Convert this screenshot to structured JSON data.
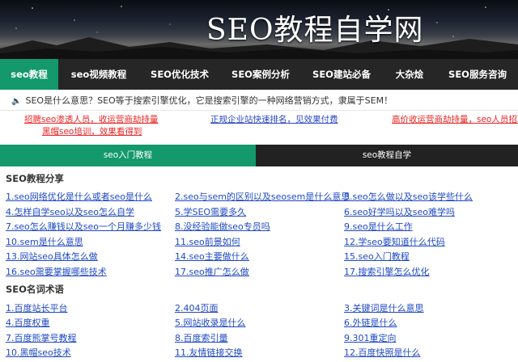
{
  "header": {
    "title": "SEO教程自学网"
  },
  "nav": [
    {
      "label": "seo教程",
      "active": true
    },
    {
      "label": "seo视频教程"
    },
    {
      "label": "SEO优化技术"
    },
    {
      "label": "SEO案例分析"
    },
    {
      "label": "SEO建站必备"
    },
    {
      "label": "大杂烩"
    },
    {
      "label": "SEO服务咨询"
    }
  ],
  "notice": {
    "text": "SEO是什么意思？SEO等于搜索引擎优化，它是搜索引擎的一种网络营销方式，隶属于SEM！"
  },
  "ads": [
    {
      "text": "招聘seo渗透人员，收运营商劫持量",
      "color": "red"
    },
    {
      "text": "黑帽seo培训，效果看得到",
      "color": "red"
    },
    {
      "text": "正规企业站快速排名，见效果付费",
      "color": "blue"
    },
    {
      "text": "高价收运营商劫持量，seo人员招聘",
      "color": "red"
    }
  ],
  "tabs": [
    {
      "label": "seo入门教程"
    },
    {
      "label": "seo教程自学"
    }
  ],
  "sections": [
    {
      "title": "SEO教程分享",
      "items": [
        "1.seo网络优化是什么或者seo是什么",
        "2.seo与sem的区别以及seosem是什么意思",
        "3.seo怎么做以及seo该学些什么",
        "4.怎样自学seo以及seo怎么自学",
        "5.学SEO需要多久",
        "6.seo好学吗以及seo难学吗",
        "7.seo怎么赚钱以及seo一个月赚多少钱",
        "8.没经验能做seo专员吗",
        "9.seo是什么工作",
        "10.sem是什么意思",
        "11.seo前景如何",
        "12.学seo要知道什么代码",
        "13.网站seo具体怎么做",
        "14.seo主要做什么",
        "15.seo入门教程",
        "16.seo需要掌握哪些技术",
        "17.seo推广怎么做",
        "17.搜索引擎怎么优化"
      ]
    },
    {
      "title": "SEO名词术语",
      "items": [
        "1.百度站长平台",
        "2.404页面",
        "3.关键词是什么意思",
        "4.百度权重",
        "5.网站收录是什么",
        "6.外链是什么",
        "7.百度熊掌号教程",
        "8.百度索引量",
        "9.301重定向",
        "10.黑帽seo技术",
        "11.友情链接交换",
        "12.百度快照是什么"
      ]
    }
  ],
  "colors": {
    "accent": "#13996b",
    "nav_bg": "#262626",
    "link": "#1f49c6",
    "ad_red": "#e22222"
  }
}
